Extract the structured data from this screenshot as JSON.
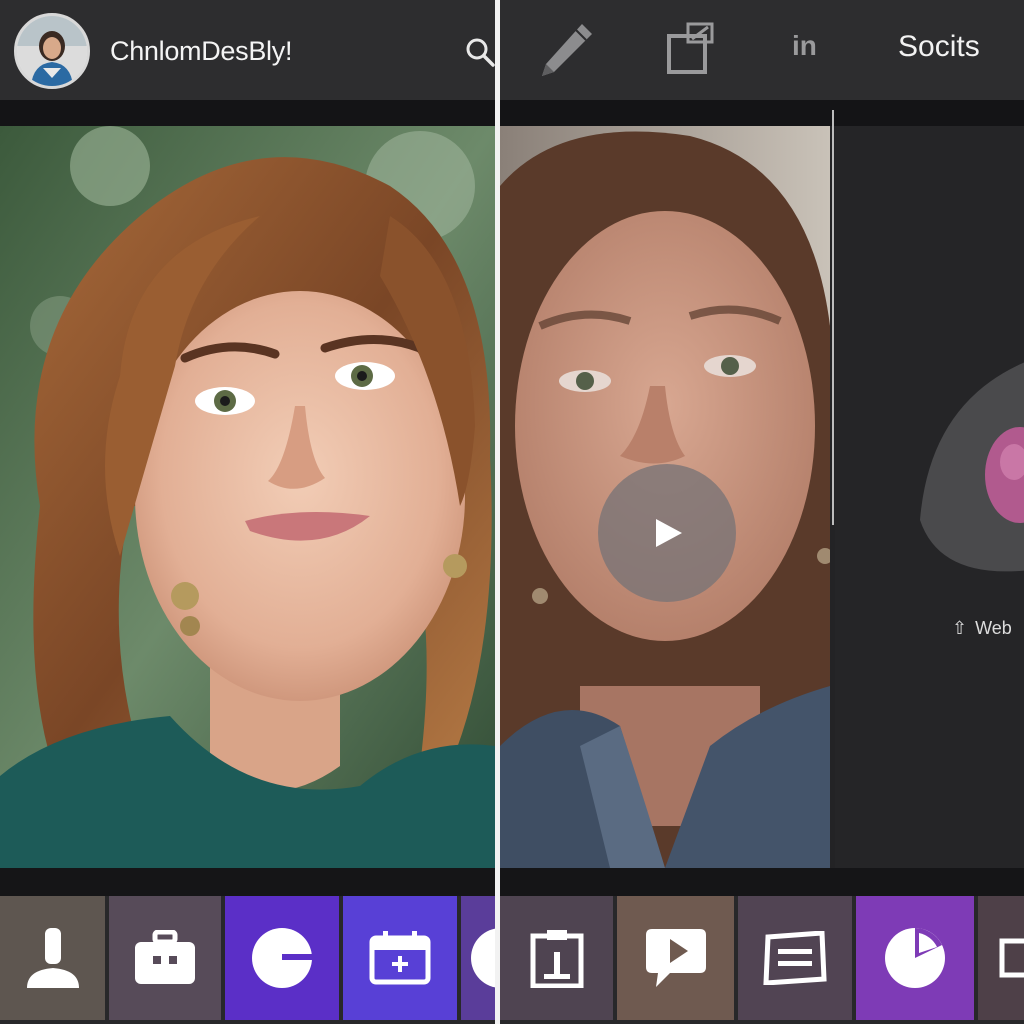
{
  "left": {
    "profile_name": "ChnlomDesBly!",
    "header_icons": [
      "avatar",
      "search-icon"
    ],
    "tabs": [
      {
        "icon": "person-icon",
        "color": "#5e5650"
      },
      {
        "icon": "briefcase-icon",
        "color": "#574b59"
      },
      {
        "icon": "pie-chart-icon",
        "color": "#5b2fc7"
      },
      {
        "icon": "calendar-add-icon",
        "color": "#5840d6"
      },
      {
        "icon": "partial-icon",
        "color": "#5a3d9a"
      }
    ]
  },
  "right": {
    "header_icons": [
      "pencil-icon",
      "edit-square-icon",
      "linkedin-icon"
    ],
    "linkedin_text": "in",
    "socials_label": "Socits",
    "web_link": "Web",
    "tabs": [
      {
        "icon": "clipboard-icon",
        "color": "#4f4451"
      },
      {
        "icon": "play-chat-icon",
        "color": "#6f5a50"
      },
      {
        "icon": "ticket-icon",
        "color": "#514453"
      },
      {
        "icon": "pie-chart-icon",
        "color": "#7e3bb6"
      },
      {
        "icon": "partial-icon",
        "color": "#4e4048"
      }
    ]
  },
  "colors": {
    "background": "#232325",
    "header": "#2d2d2f",
    "accent_purple": "#5b2fc7",
    "text": "#f4f4f4"
  }
}
